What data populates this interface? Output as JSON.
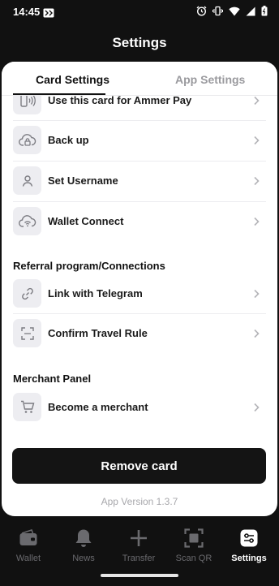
{
  "status_bar": {
    "time": "14:45"
  },
  "header": {
    "title": "Settings"
  },
  "tabs": [
    {
      "label": "Card Settings",
      "active": true
    },
    {
      "label": "App Settings",
      "active": false
    }
  ],
  "card_items": [
    {
      "label": "Use this card for Ammer Pay",
      "icon": "nfc-pay-icon"
    },
    {
      "label": "Back up",
      "icon": "cloud-lock-icon"
    },
    {
      "label": "Set Username",
      "icon": "user-icon"
    },
    {
      "label": "Wallet Connect",
      "icon": "cloud-wifi-icon"
    }
  ],
  "referral": {
    "title": "Referral program/Connections",
    "items": [
      {
        "label": "Link with Telegram",
        "icon": "link-icon"
      },
      {
        "label": "Confirm Travel Rule",
        "icon": "scan-frame-icon"
      }
    ]
  },
  "merchant": {
    "title": "Merchant Panel",
    "items": [
      {
        "label": "Become a merchant",
        "icon": "cart-icon"
      }
    ]
  },
  "remove_button": "Remove card",
  "app_version": "App Version 1.3.7",
  "bottom_nav": [
    {
      "label": "Wallet",
      "icon": "wallet-icon",
      "active": false
    },
    {
      "label": "News",
      "icon": "bell-icon",
      "active": false
    },
    {
      "label": "Transfer",
      "icon": "plus-icon",
      "active": false
    },
    {
      "label": "Scan QR",
      "icon": "scan-qr-icon",
      "active": false
    },
    {
      "label": "Settings",
      "icon": "settings-icon",
      "active": true
    }
  ]
}
